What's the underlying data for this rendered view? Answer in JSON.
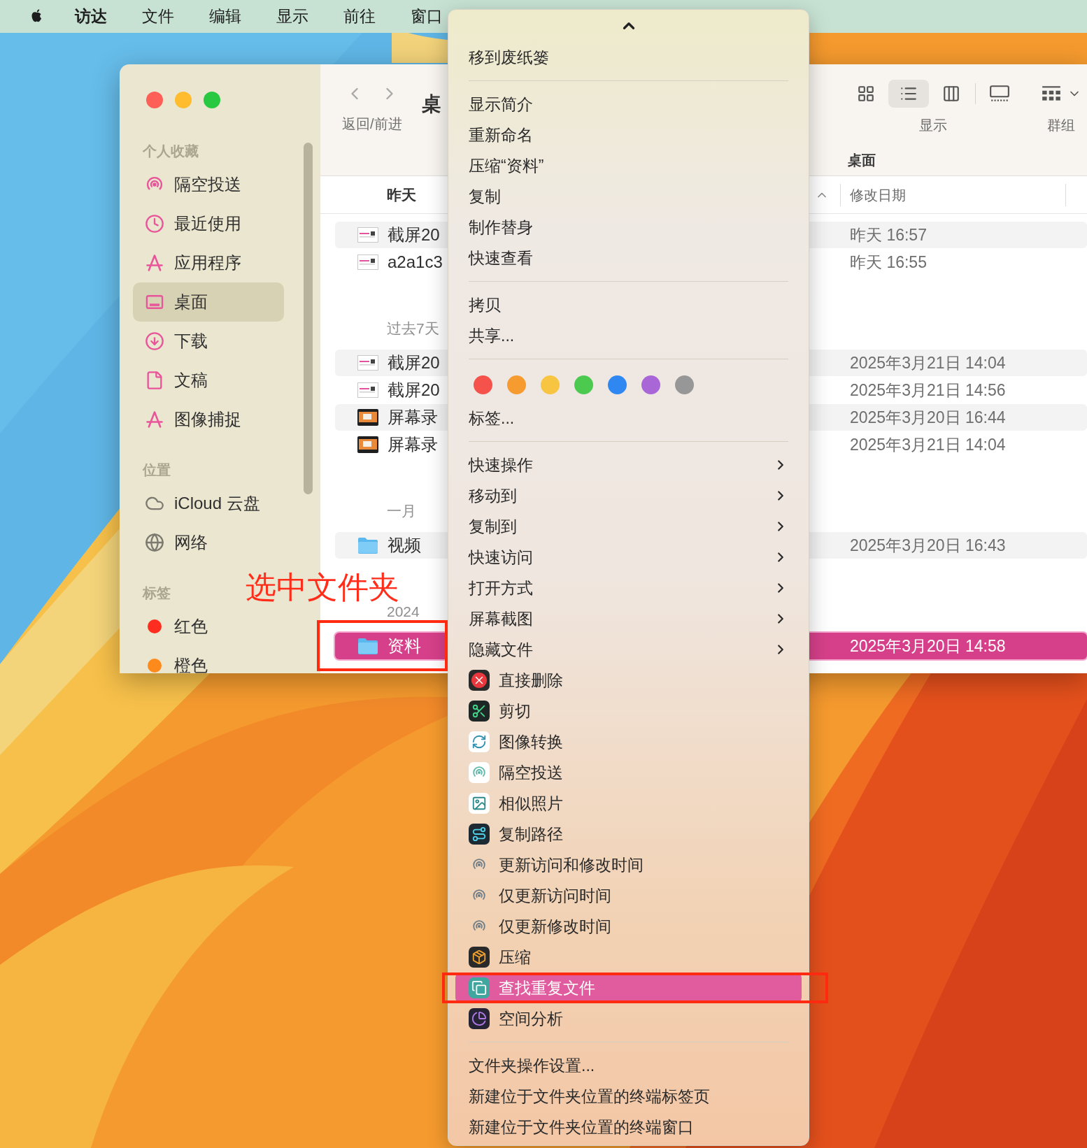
{
  "menu_bar": {
    "items": [
      {
        "label": "访达",
        "kind": "app_name"
      },
      {
        "label": "文件",
        "kind": "menu"
      },
      {
        "label": "编辑",
        "kind": "menu"
      },
      {
        "label": "显示",
        "kind": "menu"
      },
      {
        "label": "前往",
        "kind": "menu"
      },
      {
        "label": "窗口",
        "kind": "menu"
      }
    ]
  },
  "finder": {
    "sidebar": {
      "sections": [
        {
          "title": "个人收藏",
          "items": [
            {
              "label": "隔空投送",
              "selected": false
            },
            {
              "label": "最近使用",
              "selected": false
            },
            {
              "label": "应用程序",
              "selected": false
            },
            {
              "label": "桌面",
              "selected": true
            },
            {
              "label": "下载",
              "selected": false
            },
            {
              "label": "文稿",
              "selected": false
            },
            {
              "label": "图像捕捉",
              "selected": false
            }
          ]
        },
        {
          "title": "位置",
          "items": [
            {
              "label": "iCloud 云盘",
              "selected": false
            },
            {
              "label": "网络",
              "selected": false
            }
          ]
        },
        {
          "title": "标签",
          "items": [
            {
              "label": "红色",
              "color": "#ff2d1f",
              "selected": false
            },
            {
              "label": "橙色",
              "color": "#ff8a1c",
              "selected": false
            }
          ]
        }
      ]
    },
    "toolbar": {
      "nav_label": "返回/前进",
      "title": "桌",
      "view_label": "显示",
      "group_label": "群组",
      "views": [
        {
          "selected": false
        },
        {
          "selected": true
        },
        {
          "selected": false
        },
        {
          "selected": false
        }
      ]
    },
    "path_label": "桌面",
    "date_column": "修改日期",
    "groups": [
      {
        "title": "昨天",
        "rows": [
          {
            "kind": "screenshot",
            "name": "截屏20",
            "date": "昨天 16:57",
            "selected": false
          },
          {
            "kind": "screenshot",
            "name": "a2a1c3",
            "date": "昨天 16:55",
            "selected": false
          }
        ]
      },
      {
        "title": "过去7天",
        "rows": [
          {
            "kind": "screenshot",
            "name": "截屏20",
            "date": "2025年3月21日 14:04",
            "selected": false
          },
          {
            "kind": "screenshot",
            "name": "截屏20",
            "date": "2025年3月21日 14:56",
            "selected": false
          },
          {
            "kind": "video",
            "name": "屏幕录",
            "date": "2025年3月20日 16:44",
            "selected": false
          },
          {
            "kind": "video",
            "name": "屏幕录",
            "date": "2025年3月21日 14:04",
            "selected": false
          }
        ]
      },
      {
        "title": "一月",
        "rows": [
          {
            "kind": "folder",
            "name": "视频",
            "date": "2025年3月20日 16:43",
            "selected": false
          }
        ]
      },
      {
        "title": "2024",
        "rows": [
          {
            "kind": "folder",
            "name": "资料",
            "date": "2025年3月20日 14:58",
            "selected": true
          }
        ]
      }
    ]
  },
  "annotation": {
    "text": "选中文件夹"
  },
  "context_menu": {
    "sections": [
      {
        "items": [
          {
            "label": "移到废纸篓",
            "kind": "text",
            "selected": false
          }
        ]
      },
      {
        "items": [
          {
            "label": "显示简介",
            "kind": "text",
            "selected": false
          },
          {
            "label": "重新命名",
            "kind": "text",
            "selected": false
          },
          {
            "label": "压缩“资料”",
            "kind": "text",
            "selected": false
          },
          {
            "label": "复制",
            "kind": "text",
            "selected": false
          },
          {
            "label": "制作替身",
            "kind": "text",
            "selected": false
          },
          {
            "label": "快速查看",
            "kind": "text",
            "selected": false
          }
        ]
      },
      {
        "items": [
          {
            "label": "拷贝",
            "kind": "text",
            "selected": false
          },
          {
            "label": "共享...",
            "kind": "text",
            "selected": false
          }
        ]
      },
      {
        "tag_colors": [
          {
            "color": "#f5524c"
          },
          {
            "color": "#f59b30"
          },
          {
            "color": "#f7c541"
          },
          {
            "color": "#4cca50"
          },
          {
            "color": "#2f87f2"
          },
          {
            "color": "#a866d6"
          },
          {
            "color": "#979797"
          }
        ],
        "items": [
          {
            "label": "标签...",
            "kind": "text",
            "selected": false
          }
        ]
      },
      {
        "items": [
          {
            "label": "快速操作",
            "kind": "submenu",
            "selected": false
          },
          {
            "label": "移动到",
            "kind": "submenu",
            "selected": false
          },
          {
            "label": "复制到",
            "kind": "submenu",
            "selected": false
          },
          {
            "label": "快速访问",
            "kind": "submenu",
            "selected": false
          },
          {
            "label": "打开方式",
            "kind": "submenu",
            "selected": false
          },
          {
            "label": "屏幕截图",
            "kind": "submenu",
            "selected": false
          },
          {
            "label": "隐藏文件",
            "kind": "submenu",
            "selected": false
          },
          {
            "label": "直接删除",
            "kind": "app",
            "selected": false
          },
          {
            "label": "剪切",
            "kind": "app",
            "selected": false
          },
          {
            "label": "图像转换",
            "kind": "app",
            "selected": false
          },
          {
            "label": "隔空投送",
            "kind": "app",
            "selected": false
          },
          {
            "label": "相似照片",
            "kind": "app",
            "selected": false
          },
          {
            "label": "复制路径",
            "kind": "app",
            "selected": false
          },
          {
            "label": "更新访问和修改时间",
            "kind": "app",
            "selected": false
          },
          {
            "label": "仅更新访问时间",
            "kind": "app",
            "selected": false
          },
          {
            "label": "仅更新修改时间",
            "kind": "app",
            "selected": false
          },
          {
            "label": "压缩",
            "kind": "app",
            "selected": false
          },
          {
            "label": "查找重复文件",
            "kind": "app",
            "selected": true
          },
          {
            "label": "空间分析",
            "kind": "app",
            "selected": false
          }
        ]
      },
      {
        "items": [
          {
            "label": "文件夹操作设置...",
            "kind": "text",
            "selected": false
          },
          {
            "label": "新建位于文件夹位置的终端标签页",
            "kind": "text",
            "selected": false
          },
          {
            "label": "新建位于文件夹位置的终端窗口",
            "kind": "text",
            "selected": false
          }
        ]
      }
    ]
  }
}
